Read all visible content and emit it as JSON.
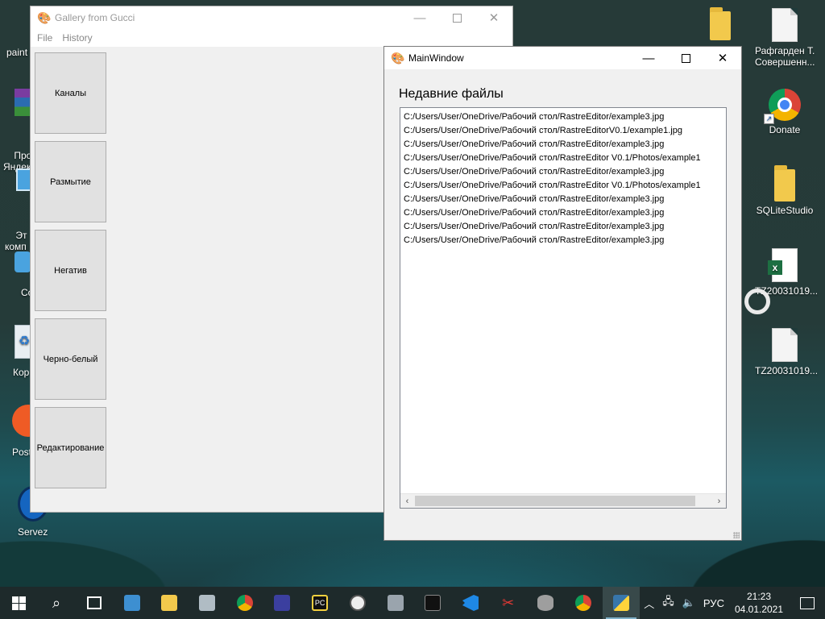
{
  "desktop": {
    "left_icons": [
      {
        "label": "paint"
      },
      {
        "label": "Прое\nЯндек"
      },
      {
        "label": "Эт\nкомп"
      },
      {
        "label": "Co"
      },
      {
        "label": "Кор"
      },
      {
        "label": "Post"
      },
      {
        "label": "Servez"
      }
    ],
    "right_icons": [
      {
        "label": ""
      },
      {
        "label": "Рафгарден Т.\nСовершенн..."
      },
      {
        "label": "Donate"
      },
      {
        "label": "SQLiteStudio"
      },
      {
        "label": "TZ20031019..."
      },
      {
        "label": "TZ20031019..."
      }
    ]
  },
  "gallery_window": {
    "title": "Gallery from Gucci",
    "menu": [
      "File",
      "History"
    ],
    "buttons": [
      "Каналы",
      "Размытие",
      "Негатив",
      "Черно-белый",
      "Редактирование"
    ]
  },
  "main_window": {
    "title": "MainWindow",
    "heading": "Недавние файлы",
    "recent_files": [
      "C:/Users/User/OneDrive/Рабочий стол/RastreEditor/example3.jpg",
      "C:/Users/User/OneDrive/Рабочий стол/RastreEditorV0.1/example1.jpg",
      "C:/Users/User/OneDrive/Рабочий стол/RastreEditor/example3.jpg",
      "C:/Users/User/OneDrive/Рабочий стол/RastreEditor V0.1/Photos/example1",
      "C:/Users/User/OneDrive/Рабочий стол/RastreEditor/example3.jpg",
      "C:/Users/User/OneDrive/Рабочий стол/RastreEditor V0.1/Photos/example1",
      "C:/Users/User/OneDrive/Рабочий стол/RastreEditor/example3.jpg",
      "C:/Users/User/OneDrive/Рабочий стол/RastreEditor/example3.jpg",
      "C:/Users/User/OneDrive/Рабочий стол/RastreEditor/example3.jpg",
      "C:/Users/User/OneDrive/Рабочий стол/RastreEditor/example3.jpg"
    ]
  },
  "taskbar": {
    "language": "РУС",
    "time": "21:23",
    "date": "04.01.2021",
    "apps": [
      "start",
      "search",
      "task-view",
      "control-panel",
      "file-explorer",
      "system-tool",
      "chrome",
      "save-app",
      "pycharm",
      "clock-app",
      "calculator",
      "terminal",
      "vscode",
      "snipping-tool",
      "database-tool",
      "chrome-alt",
      "python"
    ]
  }
}
